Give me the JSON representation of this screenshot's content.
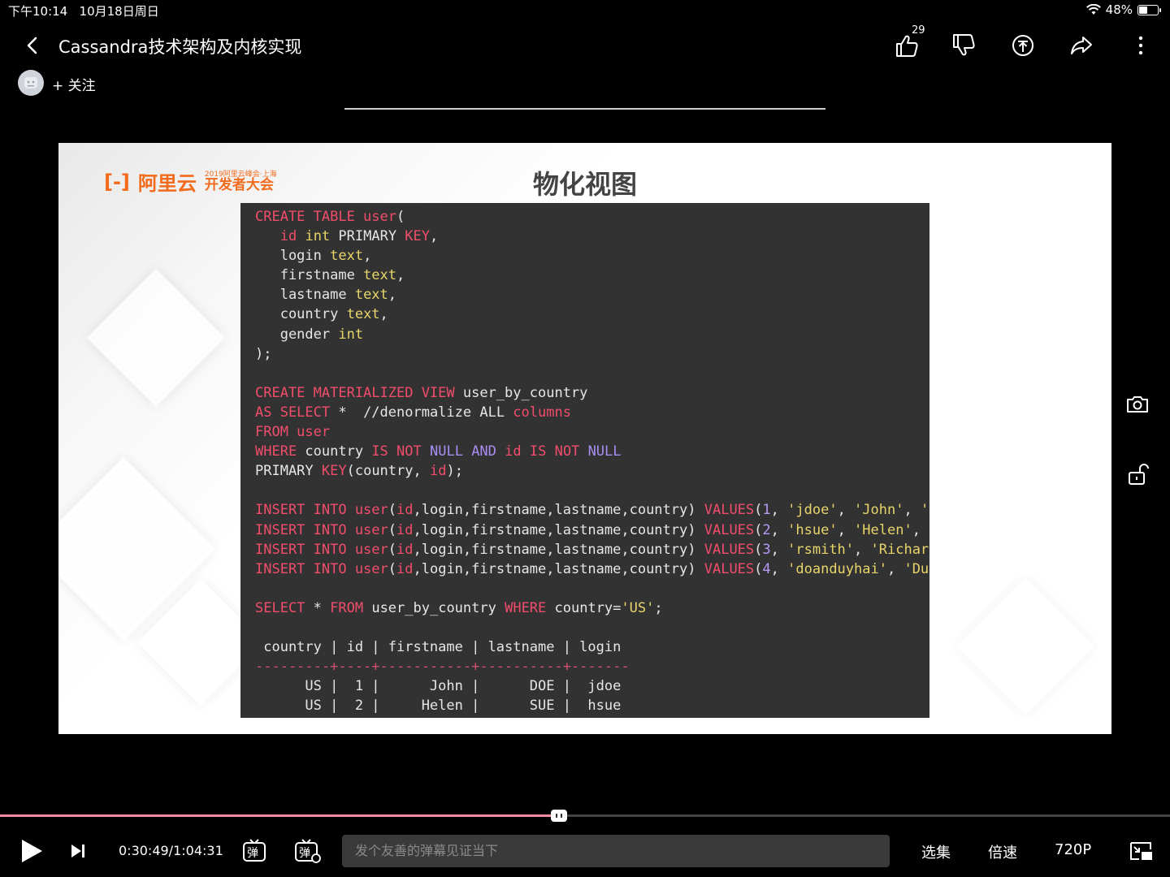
{
  "status_bar": {
    "time": "下午10:14",
    "date": "10月18日周日",
    "battery": "48%"
  },
  "header": {
    "title": "Cassandra技术架构及内核实现",
    "follow_label": "+ 关注",
    "like_count": "29"
  },
  "slide": {
    "logo_text": "阿里云",
    "logo_subtitle": "2019阿里云峰会·上海",
    "logo_event": "开发者大会",
    "title": "物化视图"
  },
  "player": {
    "time": "0:30:49/1:04:31",
    "progress": 0.478,
    "danmu_placeholder": "发个友善的弹幕见证当下",
    "episodes_label": "选集",
    "speed_label": "倍速",
    "quality_label": "720P",
    "danmu_toggle_glyph": "弹",
    "danmu_settings_glyph": "弹"
  },
  "colors": {
    "accent": "#f28aa0",
    "logo": "#f26b1d",
    "code_bg": "#323232"
  }
}
